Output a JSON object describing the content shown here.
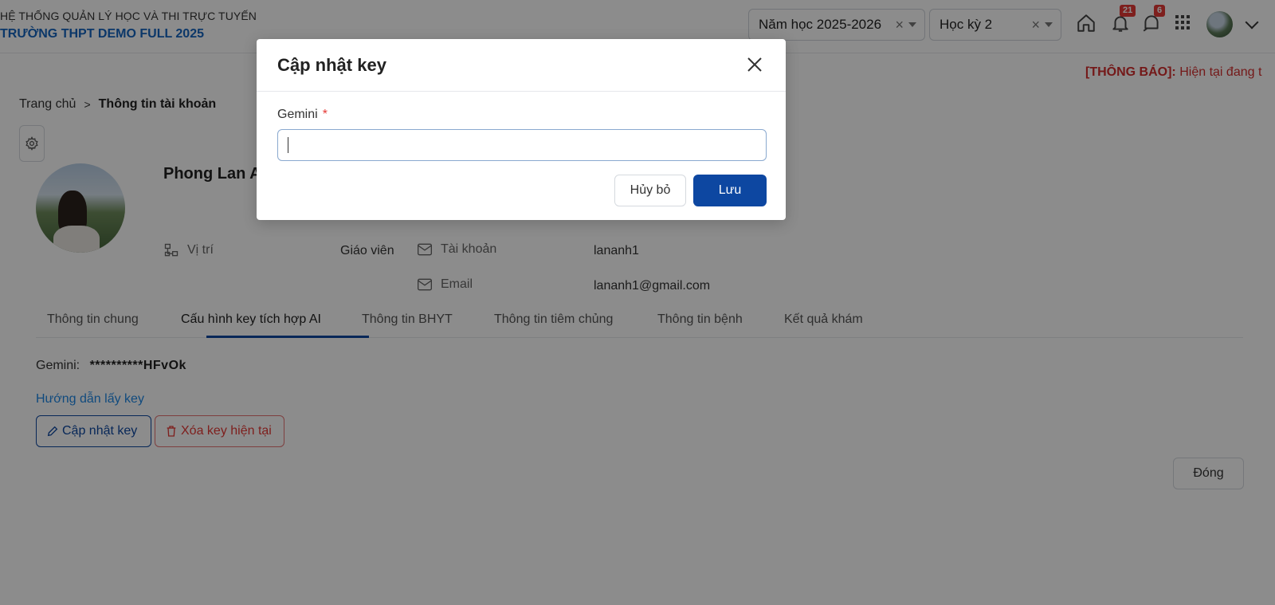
{
  "header": {
    "system_title": "HỆ THỐNG QUẢN LÝ HỌC VÀ THI TRỰC TUYẾN",
    "school_name": "TRƯỜNG THPT DEMO FULL 2025",
    "school_year": "Năm học 2025-2026",
    "semester": "Học kỳ 2",
    "notification_count": "21",
    "message_count": "6",
    "icons": [
      "home-icon",
      "bell-icon",
      "chat-bell-icon",
      "apps-grid-icon",
      "avatar",
      "chevron-down-icon"
    ]
  },
  "notice": {
    "prefix": "[THÔNG BÁO]:",
    "text": "Hiện tại đang t"
  },
  "breadcrumb": {
    "home": "Trang chủ",
    "current": "Thông tin tài khoản"
  },
  "profile": {
    "name": "Phong Lan A",
    "position_label": "Vị trí",
    "position_value": "Giáo viên",
    "account_label": "Tài khoản",
    "account_value": "lananh1",
    "email_label": "Email",
    "email_value": "lananh1@gmail.com"
  },
  "tabs": [
    {
      "label": "Thông tin chung"
    },
    {
      "label": "Cấu hình key tích hợp AI"
    },
    {
      "label": "Thông tin BHYT"
    },
    {
      "label": "Thông tin tiêm chủng"
    },
    {
      "label": "Thông tin bệnh"
    },
    {
      "label": "Kết quả khám"
    }
  ],
  "active_tab": "Cấu hình key tích hợp AI",
  "ai_config": {
    "gemini_label": "Gemini:",
    "gemini_key_masked": "**********HFvOk",
    "guide_link": "Hướng dẫn lấy key",
    "update_button": "Cập nhật key",
    "delete_button": "Xóa key hiện tại"
  },
  "close_button": "Đóng",
  "modal": {
    "title": "Cập nhật key",
    "field_label": "Gemini",
    "required_mark": "*",
    "field_value": "",
    "cancel_button": "Hủy bỏ",
    "save_button": "Lưu"
  },
  "colors": {
    "primary": "#0d47a1",
    "danger": "#e53935",
    "notice": "#d32f2f",
    "link": "#1e88e5"
  }
}
